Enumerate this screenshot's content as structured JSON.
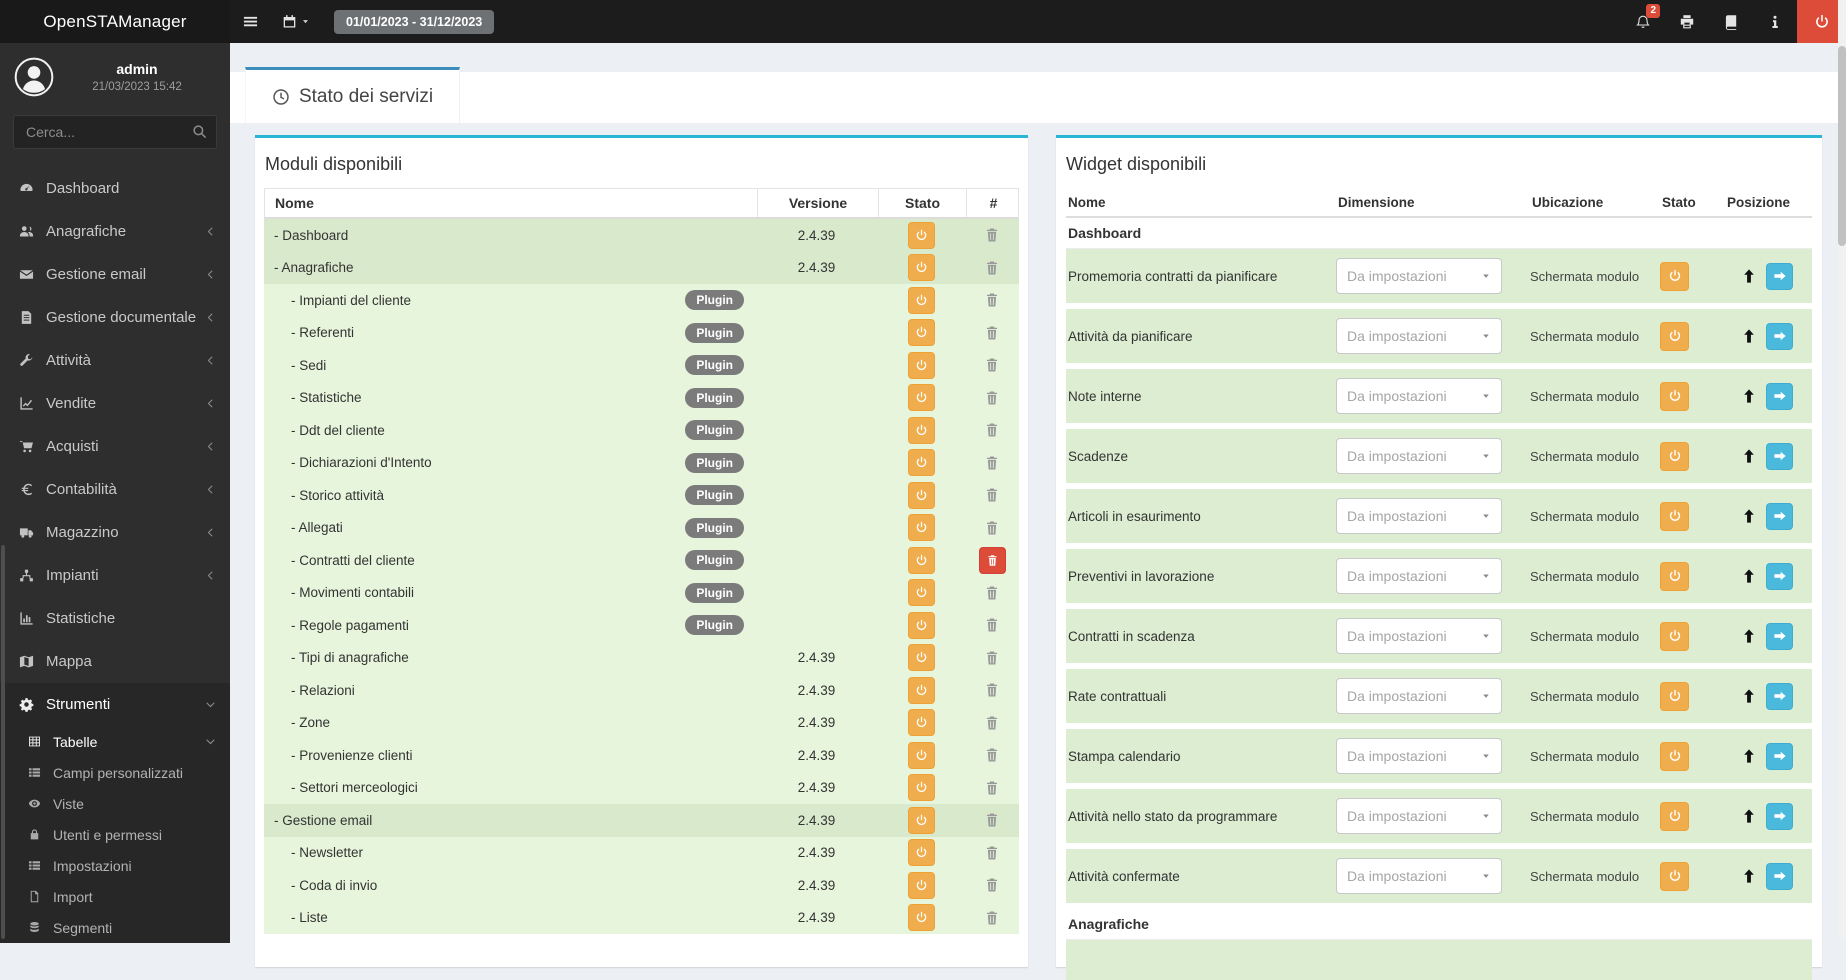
{
  "navbar": {
    "logo": "OpenSTAManager",
    "date_range": "01/01/2023 - 31/12/2023",
    "notifications": "2"
  },
  "sidebar": {
    "user_name": "admin",
    "user_datetime": "21/03/2023 15:42",
    "search_placeholder": "Cerca...",
    "items": [
      {
        "icon": "gauge",
        "label": "Dashboard"
      },
      {
        "icon": "users",
        "label": "Anagrafiche",
        "chevron": "left"
      },
      {
        "icon": "envelope",
        "label": "Gestione email",
        "chevron": "left"
      },
      {
        "icon": "file-text",
        "label": "Gestione documentale",
        "chevron": "left"
      },
      {
        "icon": "wrench",
        "label": "Attività",
        "chevron": "left"
      },
      {
        "icon": "chart-line",
        "label": "Vendite",
        "chevron": "left"
      },
      {
        "icon": "cart",
        "label": "Acquisti",
        "chevron": "left"
      },
      {
        "icon": "euro",
        "label": "Contabilità",
        "chevron": "left"
      },
      {
        "icon": "truck",
        "label": "Magazzino",
        "chevron": "left"
      },
      {
        "icon": "sitemap",
        "label": "Impianti",
        "chevron": "left"
      },
      {
        "icon": "chart-bar",
        "label": "Statistiche"
      },
      {
        "icon": "map",
        "label": "Mappa"
      },
      {
        "icon": "gear",
        "label": "Strumenti",
        "chevron": "down",
        "open": true,
        "active": true
      },
      {
        "icon": "table",
        "label": "Tabelle",
        "chevron": "down",
        "sub": true,
        "active": true
      },
      {
        "icon": "th-list",
        "label": "Campi personalizzati",
        "sub": true
      },
      {
        "icon": "eye",
        "label": "Viste",
        "sub": true
      },
      {
        "icon": "lock",
        "label": "Utenti e permessi",
        "sub": true
      },
      {
        "icon": "th-list",
        "label": "Impostazioni",
        "sub": true
      },
      {
        "icon": "file",
        "label": "Import",
        "sub": true
      },
      {
        "icon": "database",
        "label": "Segmenti",
        "sub": true
      }
    ]
  },
  "tab": {
    "label": "Stato dei servizi"
  },
  "modules": {
    "title": "Moduli disponibili",
    "columns": [
      "Nome",
      "Versione",
      "Stato",
      "#"
    ],
    "plugin_badge": "Plugin",
    "rows": [
      {
        "name": "- Dashboard",
        "version": "2.4.39",
        "level": 0
      },
      {
        "name": "- Anagrafiche",
        "version": "2.4.39",
        "level": 0
      },
      {
        "name": "- Impianti del cliente",
        "plugin": true,
        "level": 1
      },
      {
        "name": "- Referenti",
        "plugin": true,
        "level": 1
      },
      {
        "name": "- Sedi",
        "plugin": true,
        "level": 1
      },
      {
        "name": "- Statistiche",
        "plugin": true,
        "level": 1
      },
      {
        "name": "- Ddt del cliente",
        "plugin": true,
        "level": 1
      },
      {
        "name": "- Dichiarazioni d'Intento",
        "plugin": true,
        "level": 1
      },
      {
        "name": "- Storico attività",
        "plugin": true,
        "level": 1
      },
      {
        "name": "- Allegati",
        "plugin": true,
        "level": 1
      },
      {
        "name": "- Contratti del cliente",
        "plugin": true,
        "level": 1,
        "danger": true
      },
      {
        "name": "- Movimenti contabili",
        "plugin": true,
        "level": 1
      },
      {
        "name": "- Regole pagamenti",
        "plugin": true,
        "level": 1
      },
      {
        "name": "- Tipi di anagrafiche",
        "version": "2.4.39",
        "level": 1
      },
      {
        "name": "- Relazioni",
        "version": "2.4.39",
        "level": 1
      },
      {
        "name": "- Zone",
        "version": "2.4.39",
        "level": 1
      },
      {
        "name": "- Provenienze clienti",
        "version": "2.4.39",
        "level": 1
      },
      {
        "name": "- Settori merceologici",
        "version": "2.4.39",
        "level": 1
      },
      {
        "name": "- Gestione email",
        "version": "2.4.39",
        "level": 0
      },
      {
        "name": "- Newsletter",
        "version": "2.4.39",
        "level": 1
      },
      {
        "name": "- Coda di invio",
        "version": "2.4.39",
        "level": 1
      },
      {
        "name": "- Liste",
        "version": "2.4.39",
        "level": 1
      }
    ]
  },
  "widgets": {
    "title": "Widget disponibili",
    "columns": [
      "Nome",
      "Dimensione",
      "Ubicazione",
      "Stato",
      "Posizione"
    ],
    "groups": [
      {
        "header": "Dashboard",
        "rows": [
          {
            "name": "Promemoria contratti da pianificare",
            "dimension": "Da impostazioni",
            "location": "Schermata modulo"
          },
          {
            "name": "Attività da pianificare",
            "dimension": "Da impostazioni",
            "location": "Schermata modulo"
          },
          {
            "name": "Note interne",
            "dimension": "Da impostazioni",
            "location": "Schermata modulo"
          },
          {
            "name": "Scadenze",
            "dimension": "Da impostazioni",
            "location": "Schermata modulo"
          },
          {
            "name": "Articoli in esaurimento",
            "dimension": "Da impostazioni",
            "location": "Schermata modulo"
          },
          {
            "name": "Preventivi in lavorazione",
            "dimension": "Da impostazioni",
            "location": "Schermata modulo"
          },
          {
            "name": "Contratti in scadenza",
            "dimension": "Da impostazioni",
            "location": "Schermata modulo"
          },
          {
            "name": "Rate contrattuali",
            "dimension": "Da impostazioni",
            "location": "Schermata modulo"
          },
          {
            "name": "Stampa calendario",
            "dimension": "Da impostazioni",
            "location": "Schermata modulo"
          },
          {
            "name": "Attività nello stato da programmare",
            "dimension": "Da impostazioni",
            "location": "Schermata modulo"
          },
          {
            "name": "Attività confermate",
            "dimension": "Da impostazioni",
            "location": "Schermata modulo"
          }
        ]
      },
      {
        "header": "Anagrafiche",
        "rows": []
      }
    ]
  },
  "colors": {
    "tab_accent": "#3c8dbc",
    "panel_accent": "#29b6d4",
    "power": "#f0ad4e",
    "danger": "#dd4b39",
    "arrow_btn": "#4ab9dc",
    "row_module": "#d8e9cc",
    "row_plugin": "#e6f5dc",
    "row_widget": "#dcedd2"
  }
}
